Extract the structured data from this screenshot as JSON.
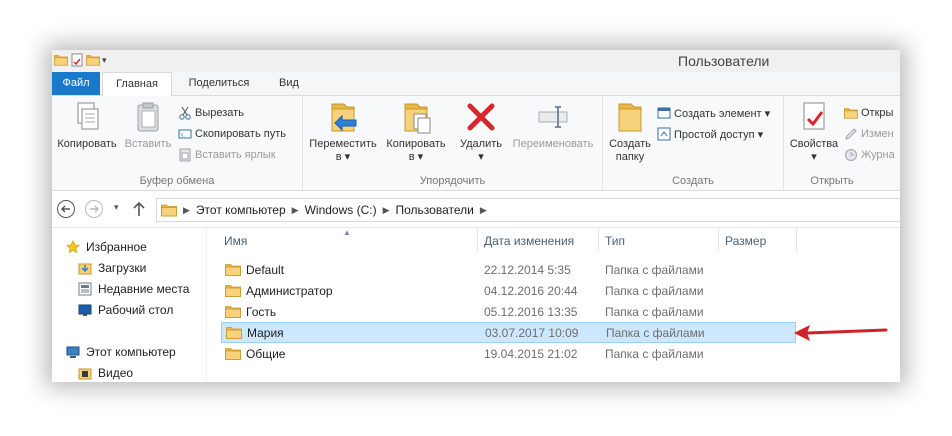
{
  "window": {
    "title": "Пользователи"
  },
  "tabs": [
    "Файл",
    "Главная",
    "Поделиться",
    "Вид"
  ],
  "ribbon": {
    "clipboard": {
      "label": "Буфер обмена",
      "copy": "Копировать",
      "paste": "Вставить",
      "cut": "Вырезать",
      "copy_path": "Скопировать путь",
      "paste_shortcut": "Вставить ярлык"
    },
    "organize": {
      "label": "Упорядочить",
      "move_to_1": "Переместить",
      "move_to_2": "в ▾",
      "copy_to_1": "Копировать",
      "copy_to_2": "в ▾",
      "delete": "Удалить",
      "delete_arrow": "▾",
      "rename": "Переименовать"
    },
    "new": {
      "label": "Создать",
      "new_folder_1": "Создать",
      "new_folder_2": "папку",
      "new_item": "Создать элемент ▾",
      "easy_access": "Простой доступ ▾"
    },
    "open": {
      "label": "Открыть",
      "properties": "Свойства",
      "properties_arrow": "▾",
      "open": "Откры",
      "edit": "Измен",
      "history": "Журна"
    }
  },
  "address": {
    "crumbs": [
      "Этот компьютер",
      "Windows (C:)",
      "Пользователи"
    ]
  },
  "nav_pane": {
    "favorites": "Избранное",
    "downloads": "Загрузки",
    "recent": "Недавние места",
    "desktop": "Рабочий стол",
    "this_pc": "Этот компьютер",
    "video": "Видео"
  },
  "columns": {
    "name": "Имя",
    "date": "Дата изменения",
    "type": "Тип",
    "size": "Размер"
  },
  "files": [
    {
      "name": "Default",
      "date": "22.12.2014 5:35",
      "type": "Папка с файлами"
    },
    {
      "name": "Администратор",
      "date": "04.12.2016 20:44",
      "type": "Папка с файлами"
    },
    {
      "name": "Гость",
      "date": "05.12.2016 13:35",
      "type": "Папка с файлами"
    },
    {
      "name": "Мария",
      "date": "03.07.2017 10:09",
      "type": "Папка с файлами"
    },
    {
      "name": "Общие",
      "date": "19.04.2015 21:02",
      "type": "Папка с файлами"
    }
  ],
  "colors": {
    "file_tab": "#1979ca",
    "selection": "#cce8ff",
    "arrow": "#d0202a",
    "folder": "#f3c662"
  }
}
